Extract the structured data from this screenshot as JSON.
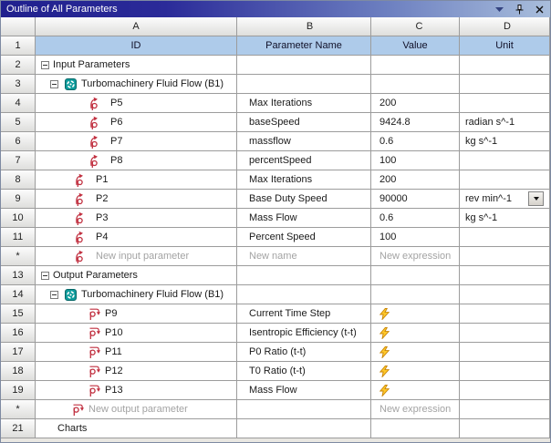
{
  "window": {
    "title": "Outline of All Parameters",
    "controls": {
      "menu": "window-menu",
      "pin": "pin",
      "close": "close"
    }
  },
  "colors": {
    "titlebar_start": "#20208E",
    "titlebar_end": "#A9BEDC",
    "header_blue": "#AECBEA",
    "param_icon_red": "#C13040",
    "system_icon_teal": "#0E9C9C",
    "lightning_yellow": "#FFC829",
    "ghost_text": "#A3A3A3",
    "grid_line": "#9C9C9C"
  },
  "table": {
    "column_letters": [
      "A",
      "B",
      "C",
      "D"
    ],
    "header_row": {
      "num": "1",
      "id": "ID",
      "name": "Parameter Name",
      "value": "Value",
      "unit": "Unit"
    },
    "rows": [
      {
        "num": "2",
        "kind": "group",
        "depth": 1,
        "expanded": true,
        "label": "Input Parameters"
      },
      {
        "num": "3",
        "kind": "system",
        "depth": 2,
        "expanded": true,
        "label": "Turbomachinery Fluid Flow (B1)"
      },
      {
        "num": "4",
        "kind": "param",
        "dir": "input",
        "depth": 4,
        "id": "P5",
        "name": "Max Iterations",
        "value": "200",
        "unit": ""
      },
      {
        "num": "5",
        "kind": "param",
        "dir": "input",
        "depth": 4,
        "id": "P6",
        "name": "baseSpeed",
        "value": "9424.8",
        "unit": "radian s^-1"
      },
      {
        "num": "6",
        "kind": "param",
        "dir": "input",
        "depth": 4,
        "id": "P7",
        "name": "massflow",
        "value": "0.6",
        "unit": "kg s^-1"
      },
      {
        "num": "7",
        "kind": "param",
        "dir": "input",
        "depth": 4,
        "id": "P8",
        "name": "percentSpeed",
        "value": "100",
        "unit": ""
      },
      {
        "num": "8",
        "kind": "param",
        "dir": "input",
        "depth": 3,
        "id": "P1",
        "name": "Max Iterations",
        "value": "200",
        "unit": ""
      },
      {
        "num": "9",
        "kind": "param",
        "dir": "input",
        "depth": 3,
        "id": "P2",
        "name": "Base Duty Speed",
        "value": "90000",
        "unit": "rev min^-1",
        "unit_combo": true
      },
      {
        "num": "10",
        "kind": "param",
        "dir": "input",
        "depth": 3,
        "id": "P3",
        "name": "Mass Flow",
        "value": "0.6",
        "unit": "kg s^-1"
      },
      {
        "num": "11",
        "kind": "param",
        "dir": "input",
        "depth": 3,
        "id": "P4",
        "name": "Percent Speed",
        "value": "100",
        "unit": ""
      },
      {
        "num": "*",
        "kind": "new-param",
        "dir": "input",
        "depth": 3,
        "id": "New input parameter",
        "name": "New name",
        "value": "New expression",
        "unit": ""
      },
      {
        "num": "13",
        "kind": "group",
        "depth": 1,
        "expanded": true,
        "label": "Output Parameters"
      },
      {
        "num": "14",
        "kind": "system",
        "depth": 2,
        "expanded": true,
        "label": "Turbomachinery Fluid Flow (B1)"
      },
      {
        "num": "15",
        "kind": "param",
        "dir": "output",
        "depth": 4,
        "id": "P9",
        "name": "Current Time Step",
        "value": "",
        "value_lightning": true,
        "unit": ""
      },
      {
        "num": "16",
        "kind": "param",
        "dir": "output",
        "depth": 4,
        "id": "P10",
        "name": "Isentropic Efficiency (t-t)",
        "value": "",
        "value_lightning": true,
        "unit": ""
      },
      {
        "num": "17",
        "kind": "param",
        "dir": "output",
        "depth": 4,
        "id": "P11",
        "name": "P0 Ratio (t-t)",
        "value": "",
        "value_lightning": true,
        "unit": ""
      },
      {
        "num": "18",
        "kind": "param",
        "dir": "output",
        "depth": 4,
        "id": "P12",
        "name": "T0 Ratio (t-t)",
        "value": "",
        "value_lightning": true,
        "unit": ""
      },
      {
        "num": "19",
        "kind": "param",
        "dir": "output",
        "depth": 4,
        "id": "P13",
        "name": "Mass Flow",
        "value": "",
        "value_lightning": true,
        "unit": ""
      },
      {
        "num": "*",
        "kind": "new-param",
        "dir": "output",
        "depth": 3,
        "id": "New output parameter",
        "name": "",
        "value": "New expression",
        "unit": ""
      },
      {
        "num": "21",
        "kind": "charts",
        "depth": 1,
        "label": "Charts"
      }
    ]
  }
}
